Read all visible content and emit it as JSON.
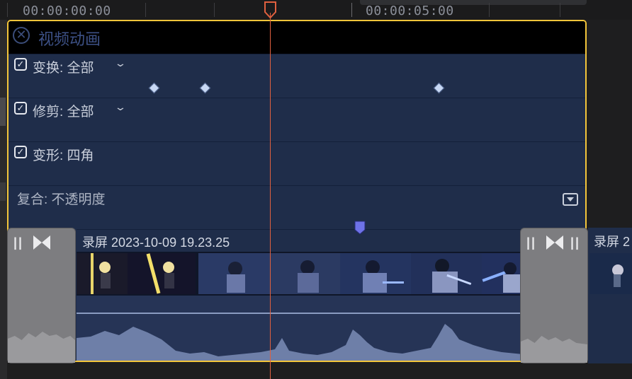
{
  "ruler": {
    "timecode_start": "00:00:00:00",
    "timecode_mid": "00:00:05:00"
  },
  "animation_editor": {
    "title": "视频动画",
    "close_icon": "close-circle-icon",
    "rows": [
      {
        "label": "变换: 全部",
        "checked": true,
        "has_menu": true
      },
      {
        "label": "修剪: 全部",
        "checked": true,
        "has_menu": true
      },
      {
        "label": "变形: 四角",
        "checked": true,
        "has_menu": false
      },
      {
        "label": "复合: 不透明度",
        "checked": false,
        "has_menu": false
      }
    ]
  },
  "clip": {
    "name": "录屏 2023-10-09 19.23.25",
    "next_clip_name": "录屏 2"
  },
  "colors": {
    "selection": "#f3c53a",
    "playhead": "#e0603f",
    "track": "#1f2d4a",
    "transition": "#7d7d80",
    "marker": "#6e72e8"
  }
}
